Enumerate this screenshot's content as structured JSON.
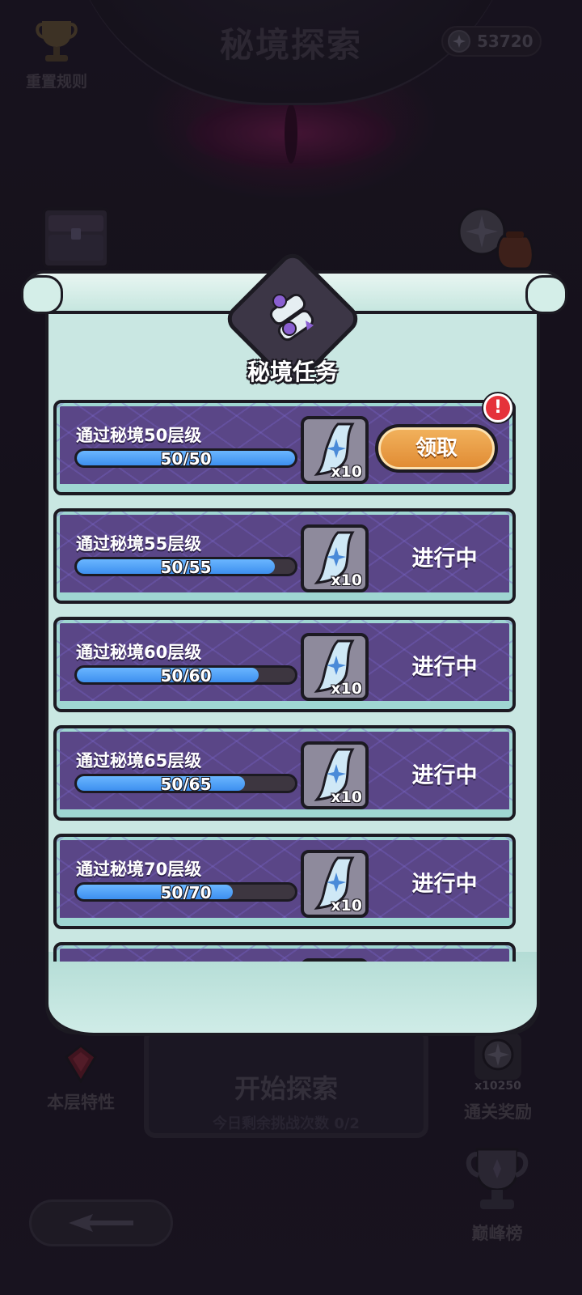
{
  "header": {
    "title": "秘境探索",
    "reset_rule_label": "重置规则",
    "currency_amount": "53720"
  },
  "popup": {
    "title": "秘境任务",
    "tasks": [
      {
        "title": "通过秘境50层级",
        "progress_text": "50/50",
        "progress": 1.0,
        "reward_qty": "x10",
        "action": "领取",
        "claimable": true
      },
      {
        "title": "通过秘境55层级",
        "progress_text": "50/55",
        "progress": 0.909,
        "reward_qty": "x10",
        "status": "进行中",
        "claimable": false
      },
      {
        "title": "通过秘境60层级",
        "progress_text": "50/60",
        "progress": 0.833,
        "reward_qty": "x10",
        "status": "进行中",
        "claimable": false
      },
      {
        "title": "通过秘境65层级",
        "progress_text": "50/65",
        "progress": 0.769,
        "reward_qty": "x10",
        "status": "进行中",
        "claimable": false
      },
      {
        "title": "通过秘境70层级",
        "progress_text": "50/70",
        "progress": 0.714,
        "reward_qty": "x10",
        "status": "进行中",
        "claimable": false
      }
    ],
    "alert_symbol": "!"
  },
  "bottom": {
    "floor_traits_label": "本层特性",
    "start_label": "开始探索",
    "remaining_label": "今日剩余挑战次数 0/2",
    "clear_reward_count": "x10250",
    "clear_reward_label": "通关奖励",
    "ranking_label": "巅峰榜"
  },
  "colors": {
    "accent_blue": "#3d8fef",
    "claim_orange": "#e08a32",
    "task_purple": "#5a4687",
    "scroll_mint": "#c9e7e2",
    "alert_red": "#e5323a"
  },
  "icons": [
    "trophy-icon",
    "coin-icon",
    "chest-icon",
    "bag-icon",
    "scroll-emblem-icon",
    "crystal-ticket-icon",
    "gem-icon",
    "ranking-cup-icon",
    "back-arrow-icon"
  ]
}
